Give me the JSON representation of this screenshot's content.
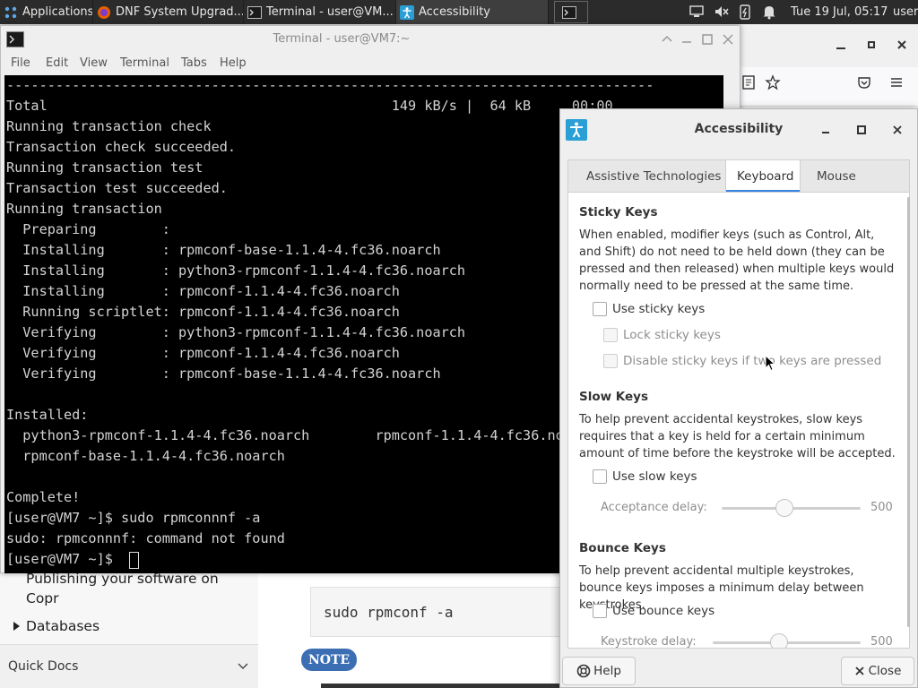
{
  "panel": {
    "apps_menu": "Applications",
    "tasks": [
      {
        "label": "DNF System Upgrad..."
      },
      {
        "label": "Terminal - user@VM..."
      },
      {
        "label": "Accessibility"
      }
    ],
    "clock": "Tue 19 Jul, 05:17",
    "user": "user"
  },
  "browser": {
    "sidebar_item_1": "Publishing your software on",
    "sidebar_item_1b": "Copr",
    "sidebar_item_2": "Databases",
    "sidebar_footer": "Quick Docs",
    "code": "sudo rpmconf -a",
    "note_badge": "NOTE"
  },
  "terminal": {
    "title": "Terminal - user@VM7:~",
    "menu": [
      "File",
      "Edit",
      "View",
      "Terminal",
      "Tabs",
      "Help"
    ],
    "lines": [
      "-------------------------------------------------------------------------------",
      "Total                                          149 kB/s |  64 kB     00:00",
      "Running transaction check",
      "Transaction check succeeded.",
      "Running transaction test",
      "Transaction test succeeded.",
      "Running transaction",
      "  Preparing        :                                                        1/1",
      "  Installing       : rpmconf-base-1.1.4-4.fc36.noarch                       1/3",
      "  Installing       : python3-rpmconf-1.1.4-4.fc36.noarch                    2/3",
      "  Installing       : rpmconf-1.1.4-4.fc36.noarch                            3/3",
      "  Running scriptlet: rpmconf-1.1.4-4.fc36.noarch                            3/3",
      "  Verifying        : python3-rpmconf-1.1.4-4.fc36.noarch                    1/3",
      "  Verifying        : rpmconf-1.1.4-4.fc36.noarch                            2/3",
      "  Verifying        : rpmconf-base-1.1.4-4.fc36.noarch                       3/3",
      "",
      "Installed:",
      "  python3-rpmconf-1.1.4-4.fc36.noarch        rpmconf-1.1.4-4.fc36.noarch",
      "  rpmconf-base-1.1.4-4.fc36.noarch",
      "",
      "Complete!",
      "[user@VM7 ~]$ sudo rpmconnnf -a",
      "sudo: rpmconnnf: command not found",
      "[user@VM7 ~]$ "
    ]
  },
  "a11y": {
    "title": "Accessibility",
    "tabs": [
      "Assistive Technologies",
      "Keyboard",
      "Mouse"
    ],
    "active_tab": "Keyboard",
    "sticky": {
      "title": "Sticky Keys",
      "desc": "When enabled, modifier keys (such as Control, Alt, and Shift) do not need to be held down (they can be pressed and then released) when multiple keys would normally need to be pressed at the same time.",
      "use": "Use sticky keys",
      "lock": "Lock sticky keys",
      "disable": "Disable sticky keys if two keys are pressed"
    },
    "slow": {
      "title": "Slow Keys",
      "desc": "To help prevent accidental keystrokes, slow keys requires that a key is held for a certain minimum amount of time before the keystroke will be accepted.",
      "use": "Use slow keys",
      "delay_label": "Acceptance delay:",
      "delay_value": "500",
      "delay_fraction": 0.45
    },
    "bounce": {
      "title": "Bounce Keys",
      "desc": "To help prevent accidental multiple keystrokes, bounce keys imposes a minimum delay between keystrokes.",
      "use": "Use bounce keys",
      "delay_label": "Keystroke delay:",
      "delay_value": "500",
      "delay_fraction": 0.45
    },
    "help_button": "Help",
    "close_button": "Close"
  },
  "colors": {
    "accent": "#3584e4",
    "a11y_icon": "#2a9fd6",
    "note_badge": "#3c6eb4"
  }
}
